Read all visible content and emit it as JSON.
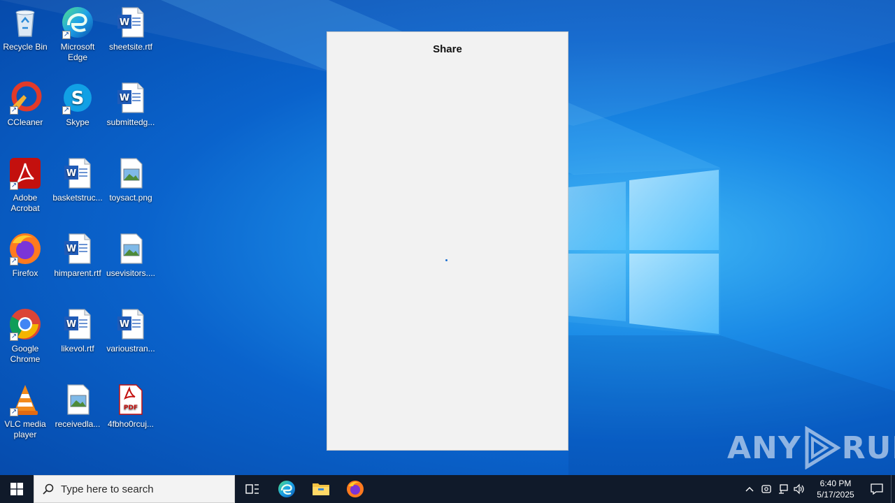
{
  "desktop": {
    "icons": [
      {
        "label": "Recycle Bin",
        "icon": "recycle-bin-icon"
      },
      {
        "label": "Microsoft Edge",
        "icon": "edge-icon"
      },
      {
        "label": "sheetsite.rtf",
        "icon": "word-document-icon"
      },
      {
        "label": "CCleaner",
        "icon": "ccleaner-icon"
      },
      {
        "label": "Skype",
        "icon": "skype-icon"
      },
      {
        "label": "submittedg...",
        "icon": "word-document-icon"
      },
      {
        "label": "Adobe Acrobat",
        "icon": "acrobat-icon"
      },
      {
        "label": "basketstruc...",
        "icon": "word-document-icon"
      },
      {
        "label": "toysact.png",
        "icon": "image-file-icon"
      },
      {
        "label": "Firefox",
        "icon": "firefox-icon"
      },
      {
        "label": "himparent.rtf",
        "icon": "word-document-icon"
      },
      {
        "label": "usevisitors....",
        "icon": "image-file-icon"
      },
      {
        "label": "Google Chrome",
        "icon": "chrome-icon"
      },
      {
        "label": "likevol.rtf",
        "icon": "word-document-icon"
      },
      {
        "label": "varioustran...",
        "icon": "word-document-icon"
      },
      {
        "label": "VLC media player",
        "icon": "vlc-icon"
      },
      {
        "label": "receivedla...",
        "icon": "image-file-icon"
      },
      {
        "label": "4fbho0rcuj...",
        "icon": "pdf-file-icon"
      }
    ]
  },
  "share_panel": {
    "title": "Share"
  },
  "watermark": {
    "left": "ANY",
    "right": "RUN"
  },
  "taskbar": {
    "search_placeholder": "Type here to search",
    "pinned": [
      "task-view-icon",
      "edge-icon",
      "file-explorer-icon",
      "firefox-icon"
    ],
    "clock_time": "6:40 PM",
    "clock_date": "5/17/2025"
  },
  "colors": {
    "taskbar_bg": "#101a2a",
    "share_bg": "#f2f2f2",
    "accent": "#1a6fd1"
  }
}
